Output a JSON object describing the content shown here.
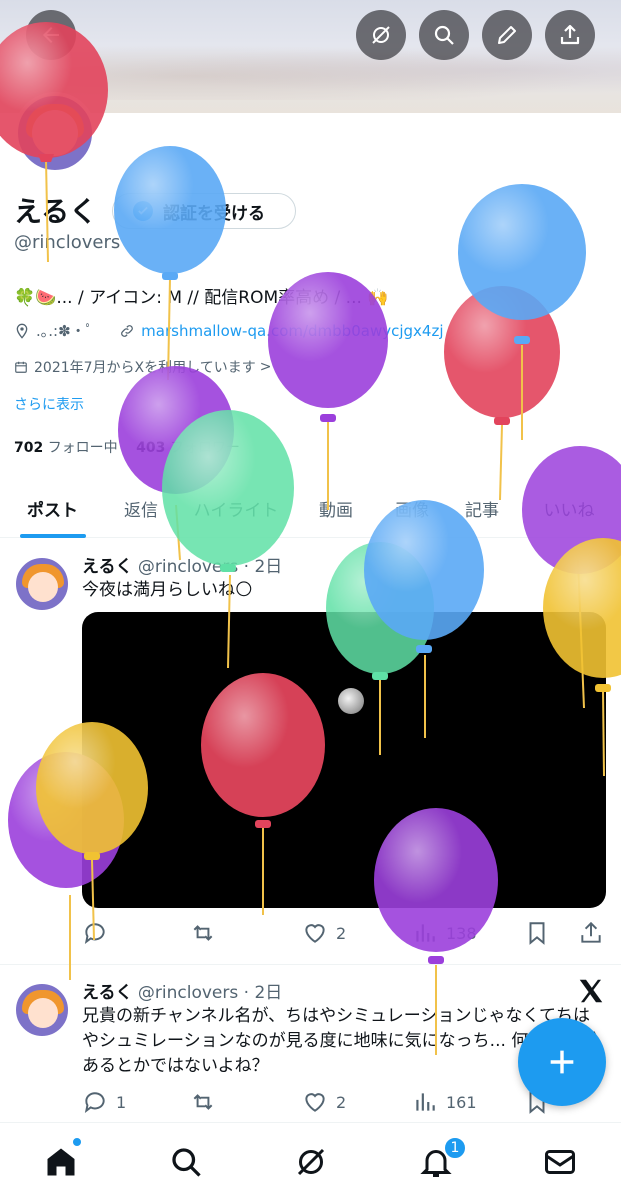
{
  "profile": {
    "name": "えるく",
    "verify_label": "認証を受ける",
    "handle": "@rinclovers",
    "bio": "🍀🍉... / アイコン: M // 配信ROM率高め / ... 🙌",
    "location": ".｡.:✽・ﾟ",
    "link": "marshmallow-qa.com/dmbb0awycjgx4zj",
    "joined": "2021年7月からXを利用しています",
    "show_more": "さらに表示",
    "following_count": "702",
    "following_label": "フォロー中",
    "followers_count": "403",
    "followers_label": "フォロワー"
  },
  "tabs": [
    {
      "label": "ポスト",
      "active": true
    },
    {
      "label": "返信"
    },
    {
      "label": "ハイライト"
    },
    {
      "label": "動画"
    },
    {
      "label": "画像"
    },
    {
      "label": "記事"
    },
    {
      "label": "いいね"
    }
  ],
  "tweets": [
    {
      "name": "えるく",
      "handle": "@rinclovers",
      "time": "2日",
      "text": "今夜は満月らしいね🌕",
      "replies": "",
      "likes": "2",
      "views": "138"
    },
    {
      "name": "えるく",
      "handle": "@rinclovers",
      "time": "2日",
      "text": "兄貴の新チャンネル名が、ちはやシミュレーションじゃなくてちはやシュミレーションなのが見る度に地味に気になっち... 何か意味があるとかではないよね？",
      "replies": "1",
      "likes": "2",
      "views": "161"
    }
  ],
  "nav": {
    "notification_badge": "1"
  },
  "icons": {
    "back": "arrow-left-icon",
    "grok": "grok-icon",
    "search": "search-icon",
    "edit": "pencil-icon",
    "share": "share-icon"
  },
  "colors": {
    "accent": "#1d9bf0",
    "balloon_red": "#e2445c",
    "balloon_blue": "#5aa9f5",
    "balloon_purple": "#9b3fdc",
    "balloon_green": "#5fe0a6",
    "balloon_yellow": "#f1c232"
  }
}
